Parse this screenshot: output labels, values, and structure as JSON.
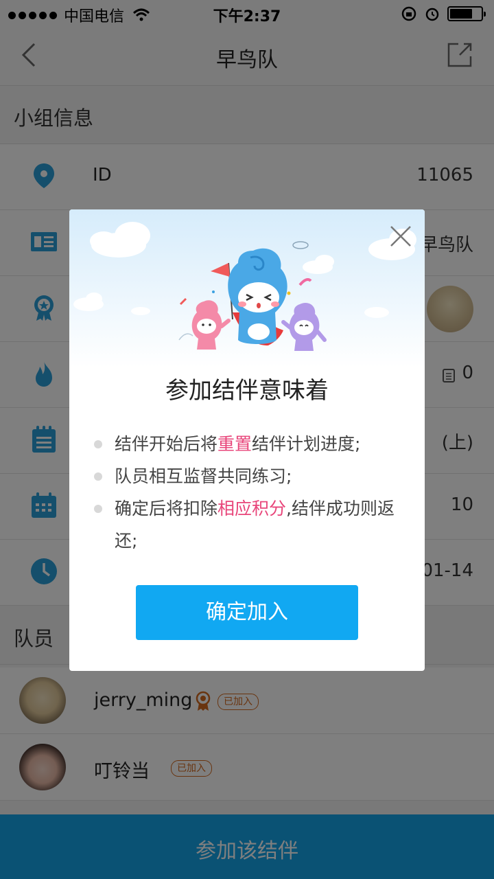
{
  "status_bar": {
    "carrier": "中国电信",
    "time": "下午2:37",
    "battery_level": 0.72
  },
  "nav": {
    "title": "早鸟队"
  },
  "group_info": {
    "header": "小组信息",
    "rows": [
      {
        "icon": "location-pin-icon",
        "label": "ID",
        "value": "11065"
      },
      {
        "icon": "id-card-icon",
        "label": "",
        "value": "早鸟队"
      },
      {
        "icon": "medal-icon",
        "label": "",
        "value": ""
      },
      {
        "icon": "flame-icon",
        "label": "",
        "value": "0"
      },
      {
        "icon": "clipboard-icon",
        "label": "",
        "value": "(上)"
      },
      {
        "icon": "calendar-icon",
        "label": "",
        "value": "10"
      },
      {
        "icon": "clock-icon",
        "label": "",
        "value": "01-14"
      }
    ]
  },
  "members": {
    "header": "队员",
    "list": [
      {
        "name": "jerry_ming",
        "badge": "已加入"
      },
      {
        "name": "叮铃当",
        "badge": "已加入"
      }
    ]
  },
  "bottom_bar": {
    "label": "参加该结伴"
  },
  "modal": {
    "title": "参加结伴意味着",
    "bullets": [
      {
        "before": "结伴开始后将",
        "highlight": "重置",
        "after": "结伴计划进度;"
      },
      {
        "before": "队员相互监督共同练习;",
        "highlight": "",
        "after": ""
      },
      {
        "before": "确定后将扣除",
        "highlight": "相应积分",
        "after": ",结伴成功则返还;"
      }
    ],
    "confirm_label": "确定加入"
  },
  "colors": {
    "accent": "#11a8f2",
    "highlight": "#e8457a",
    "icon_blue": "#2a9fd8",
    "badge": "#d2691e"
  }
}
